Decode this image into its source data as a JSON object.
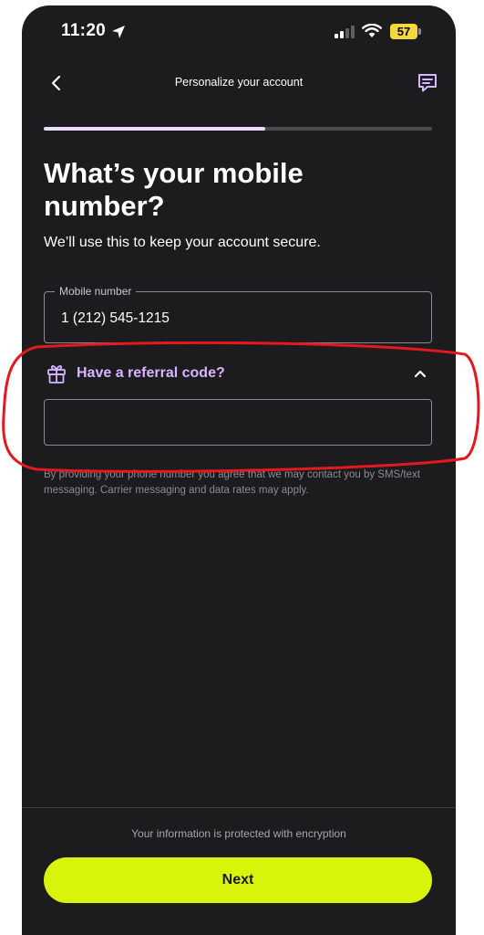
{
  "status_bar": {
    "time": "11:20",
    "battery": "57"
  },
  "header": {
    "title": "Personalize your account"
  },
  "progress": {
    "fraction": 0.57
  },
  "main": {
    "title": "What’s your mobile number?",
    "subtitle": "We’ll use this to keep your account secure.",
    "mobile_field": {
      "label": "Mobile number",
      "value": "1 (212) 545-1215"
    },
    "referral": {
      "toggle_label": "Have a referral code?",
      "value": ""
    },
    "disclaimer": "By providing your phone number you agree that we may contact you by SMS/text messaging. Carrier messaging and data rates may apply."
  },
  "footer": {
    "encryption_note": "Your information is protected with encryption",
    "next_label": "Next"
  },
  "colors": {
    "background": "#1c1b1d",
    "accent_purple": "#d7b6ff",
    "button_lime": "#d7f40a",
    "annotation_red": "#e3191d"
  },
  "icons": [
    "location-arrow-icon",
    "signal-icon",
    "wifi-icon",
    "battery-icon",
    "back-chevron-icon",
    "chat-icon",
    "gift-icon",
    "caret-up-icon"
  ]
}
